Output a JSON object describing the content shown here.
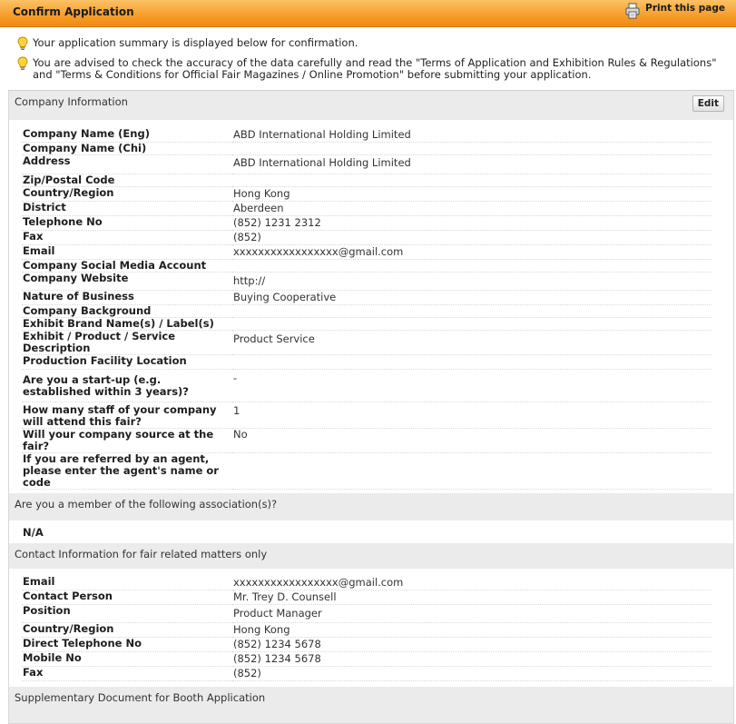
{
  "header": {
    "title": "Confirm Application",
    "print_label": "Print this page"
  },
  "notices": [
    "Your application summary is displayed below for confirmation.",
    "You are advised to check the accuracy of the data carefully and read the \"Terms of Application and Exhibition Rules & Regulations\" and \"Terms & Conditions for Official Fair Magazines / Online Promotion\" before submitting your application."
  ],
  "company": {
    "section_title": "Company Information",
    "edit_label": "Edit",
    "fields": [
      {
        "label": "Company Name (Eng)",
        "value": "ABD International Holding Limited"
      },
      {
        "label": "Company Name (Chi)",
        "value": ""
      },
      {
        "label": "Address",
        "value": "ABD International Holding Limited"
      },
      {
        "label": "Zip/Postal Code",
        "value": ""
      },
      {
        "label": "Country/Region",
        "value": "Hong Kong"
      },
      {
        "label": "District",
        "value": "Aberdeen"
      },
      {
        "label": "Telephone No",
        "value": "(852) 1231 2312"
      },
      {
        "label": "Fax",
        "value": "(852)"
      },
      {
        "label": "Email",
        "value": "xxxxxxxxxxxxxxxxx@gmail.com"
      },
      {
        "label": "Company Social Media Account",
        "value": ""
      },
      {
        "label": "Company Website",
        "value": "http://"
      },
      {
        "label": "Nature of Business",
        "value": "Buying Cooperative"
      },
      {
        "label": "Company Background",
        "value": ""
      },
      {
        "label": "Exhibit Brand Name(s) / Label(s)",
        "value": ""
      },
      {
        "label": "Exhibit / Product / Service Description",
        "value": "Product Service"
      },
      {
        "label": "Production Facility Location",
        "value": ""
      },
      {
        "label": "Are you a start-up (e.g. established within 3 years)?",
        "value": "-"
      },
      {
        "label": "How many staff of your company will attend this fair?",
        "value": "1"
      },
      {
        "label": "Will your company source at the fair?",
        "value": "No"
      },
      {
        "label": "If you are referred by an agent, please enter the agent's name or code",
        "value": ""
      }
    ]
  },
  "membership": {
    "section_title": "Are you a member of the following association(s)?",
    "value": "N/A"
  },
  "contact": {
    "section_title": "Contact Information for fair related matters only",
    "fields": [
      {
        "label": "Email",
        "value": "xxxxxxxxxxxxxxxxx@gmail.com"
      },
      {
        "label": "Contact Person",
        "value": "Mr. Trey D. Counsell"
      },
      {
        "label": "Position",
        "value": "Product Manager"
      },
      {
        "label": "Country/Region",
        "value": "Hong Kong"
      },
      {
        "label": "Direct Telephone No",
        "value": "(852) 1234 5678"
      },
      {
        "label": "Mobile No",
        "value": "(852) 1234 5678"
      },
      {
        "label": "Fax",
        "value": "(852)"
      }
    ]
  },
  "supplementary": {
    "section_title": "Supplementary Document for Booth Application"
  }
}
